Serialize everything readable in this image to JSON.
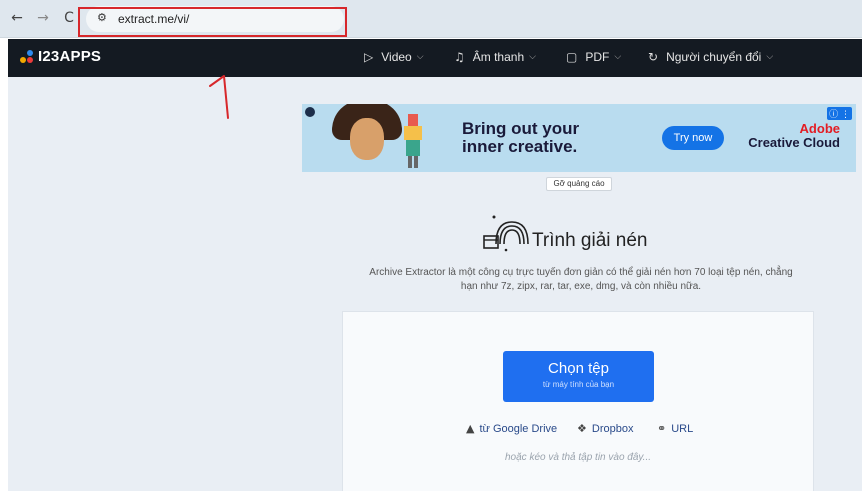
{
  "browser": {
    "back_icon": "←",
    "forward_icon": "→",
    "reload_icon": "C",
    "site_info_icon": "⚙",
    "url": "extract.me/vi/"
  },
  "annotation": {
    "box_color": "#d7272b",
    "mark": "1"
  },
  "header": {
    "logo": "I23APPS",
    "logo_dot_colors": [
      "#f2a900",
      "#ec3b3b",
      "#2e8bf0"
    ],
    "menu": [
      {
        "icon": "▷",
        "label": "Video"
      },
      {
        "icon": "♫",
        "label": "Âm thanh"
      },
      {
        "icon": "▢",
        "label": "PDF"
      },
      {
        "icon": "↻",
        "label": "Người chuyển đổi"
      }
    ],
    "chevron": "⌵"
  },
  "ad": {
    "headline_1": "Bring out your",
    "headline_2": "inner creative.",
    "button": "Try now",
    "brand_1": "Adobe",
    "brand_2": "Creative Cloud",
    "info_icon": "ⓘ ⋮",
    "remove_label": "Gỡ quảng cáo"
  },
  "tool": {
    "title": "Trình giải nén",
    "description": "Archive Extractor là một công cụ trực tuyến đơn giản có thể giải nén hơn 70 loại tệp nén, chẳng hạn như 7z, zipx, rar, tar, exe, dmg, và còn nhiều nữa.",
    "choose_button": "Chọn tệp",
    "choose_sub": "từ máy tính của bạn",
    "sources": [
      {
        "icon": "▲",
        "label": "từ Google Drive"
      },
      {
        "icon": "❖",
        "label": "Dropbox"
      },
      {
        "icon": "⚭",
        "label": "URL"
      }
    ],
    "drop_hint": "hoặc kéo và thả tập tin vào đây..."
  },
  "colors": {
    "accent": "#1f6ff0",
    "header_bg": "#141a22",
    "page_bg": "#e9eef4"
  }
}
